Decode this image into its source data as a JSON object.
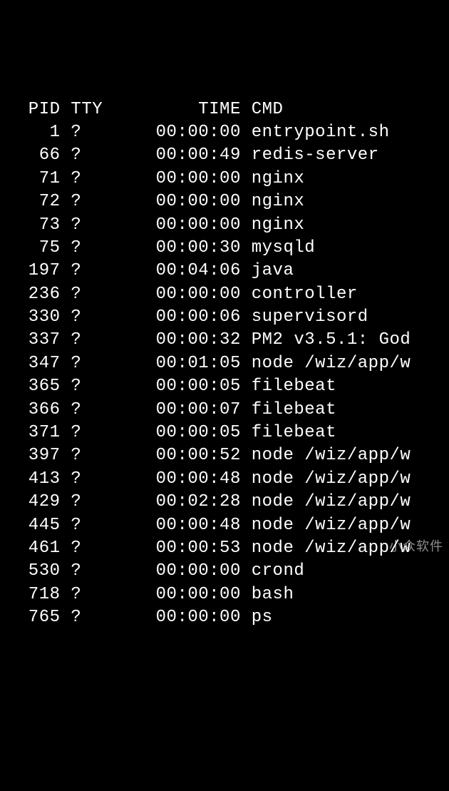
{
  "header": {
    "pid": "PID",
    "tty": "TTY",
    "time": "TIME",
    "cmd": "CMD"
  },
  "rows": [
    {
      "pid": "1",
      "tty": "?",
      "time": "00:00:00",
      "cmd": "entrypoint.sh"
    },
    {
      "pid": "66",
      "tty": "?",
      "time": "00:00:49",
      "cmd": "redis-server"
    },
    {
      "pid": "71",
      "tty": "?",
      "time": "00:00:00",
      "cmd": "nginx"
    },
    {
      "pid": "72",
      "tty": "?",
      "time": "00:00:00",
      "cmd": "nginx"
    },
    {
      "pid": "73",
      "tty": "?",
      "time": "00:00:00",
      "cmd": "nginx"
    },
    {
      "pid": "75",
      "tty": "?",
      "time": "00:00:30",
      "cmd": "mysqld"
    },
    {
      "pid": "197",
      "tty": "?",
      "time": "00:04:06",
      "cmd": "java"
    },
    {
      "pid": "236",
      "tty": "?",
      "time": "00:00:00",
      "cmd": "controller"
    },
    {
      "pid": "330",
      "tty": "?",
      "time": "00:00:06",
      "cmd": "supervisord"
    },
    {
      "pid": "337",
      "tty": "?",
      "time": "00:00:32",
      "cmd": "PM2 v3.5.1: God"
    },
    {
      "pid": "347",
      "tty": "?",
      "time": "00:01:05",
      "cmd": "node /wiz/app/w"
    },
    {
      "pid": "365",
      "tty": "?",
      "time": "00:00:05",
      "cmd": "filebeat"
    },
    {
      "pid": "366",
      "tty": "?",
      "time": "00:00:07",
      "cmd": "filebeat"
    },
    {
      "pid": "371",
      "tty": "?",
      "time": "00:00:05",
      "cmd": "filebeat"
    },
    {
      "pid": "397",
      "tty": "?",
      "time": "00:00:52",
      "cmd": "node /wiz/app/w"
    },
    {
      "pid": "413",
      "tty": "?",
      "time": "00:00:48",
      "cmd": "node /wiz/app/w"
    },
    {
      "pid": "429",
      "tty": "?",
      "time": "00:02:28",
      "cmd": "node /wiz/app/w"
    },
    {
      "pid": "445",
      "tty": "?",
      "time": "00:00:48",
      "cmd": "node /wiz/app/w"
    },
    {
      "pid": "461",
      "tty": "?",
      "time": "00:00:53",
      "cmd": "node /wiz/app/w"
    },
    {
      "pid": "530",
      "tty": "?",
      "time": "00:00:00",
      "cmd": "crond"
    },
    {
      "pid": "718",
      "tty": "?",
      "time": "00:00:00",
      "cmd": "bash"
    },
    {
      "pid": "765",
      "tty": "?",
      "time": "00:00:00",
      "cmd": "ps"
    }
  ],
  "watermark": "小众软件"
}
